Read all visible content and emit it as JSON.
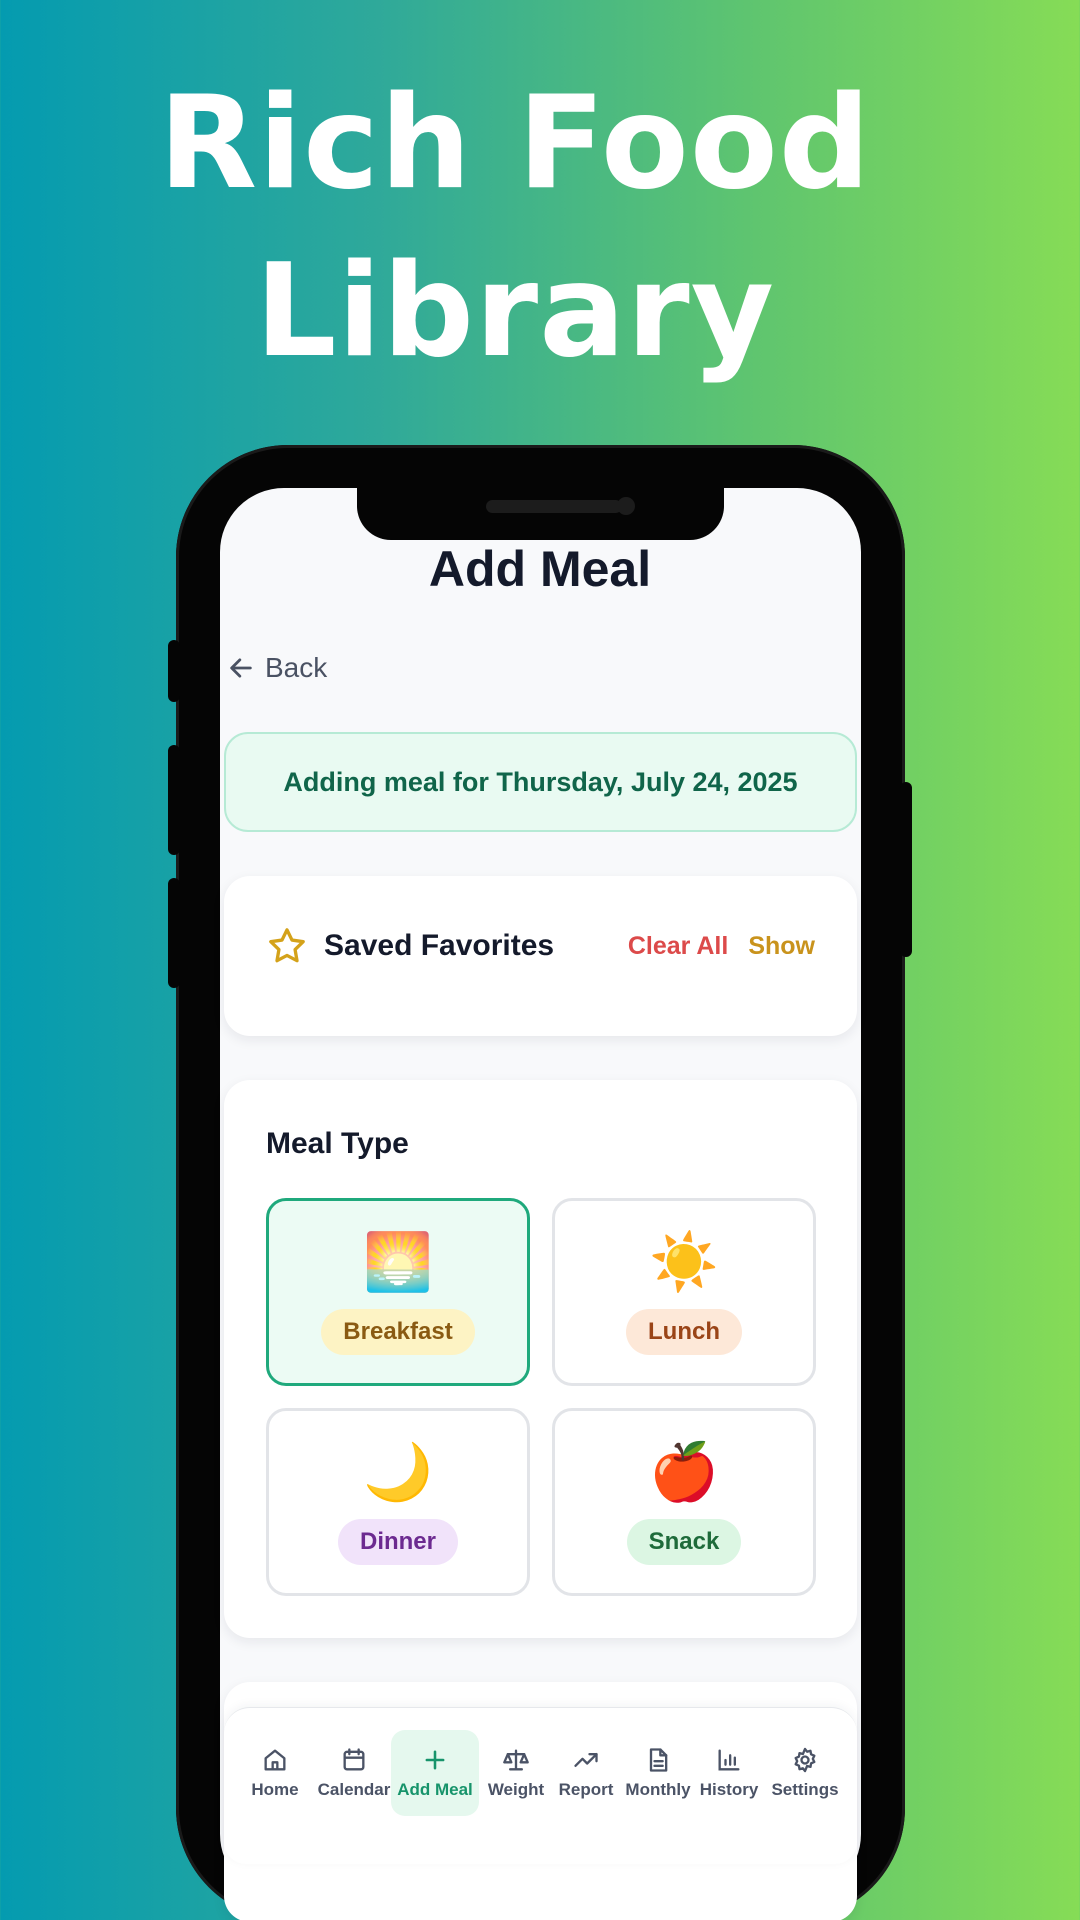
{
  "headline": {
    "line1": "Rich Food",
    "line2": "Library"
  },
  "screen": {
    "title": "Add Meal",
    "back_label": "Back",
    "date_banner": "Adding meal for Thursday, July 24, 2025",
    "favorites": {
      "title": "Saved Favorites",
      "clear_label": "Clear All",
      "show_label": "Show",
      "icon": "star-icon"
    },
    "meal_type": {
      "title": "Meal Type",
      "selected": "Breakfast",
      "options": [
        {
          "label": "Breakfast",
          "emoji": "🌅",
          "pill_bg": "#fdf3c4",
          "pill_fg": "#8a5a12"
        },
        {
          "label": "Lunch",
          "emoji": "☀️",
          "pill_bg": "#fde8d8",
          "pill_fg": "#9a4417"
        },
        {
          "label": "Dinner",
          "emoji": "🌙",
          "pill_bg": "#f1e3fa",
          "pill_fg": "#6c2a90"
        },
        {
          "label": "Snack",
          "emoji": "🍎",
          "pill_bg": "#dcf6e3",
          "pill_fg": "#1e6b3a"
        }
      ]
    },
    "nav": {
      "active": "Add Meal",
      "items": [
        {
          "label": "Home",
          "icon": "home-icon"
        },
        {
          "label": "Calendar",
          "icon": "calendar-icon"
        },
        {
          "label": "Add Meal",
          "icon": "plus-icon"
        },
        {
          "label": "Weight",
          "icon": "scale-icon"
        },
        {
          "label": "Report",
          "icon": "trending-up-icon"
        },
        {
          "label": "Monthly",
          "icon": "document-icon"
        },
        {
          "label": "History",
          "icon": "bar-chart-icon"
        },
        {
          "label": "Settings",
          "icon": "gear-icon"
        }
      ]
    }
  },
  "colors": {
    "accent": "#1fa97c",
    "danger": "#dc4a4a",
    "warning": "#c9931c",
    "title_text": "#141a2b"
  }
}
